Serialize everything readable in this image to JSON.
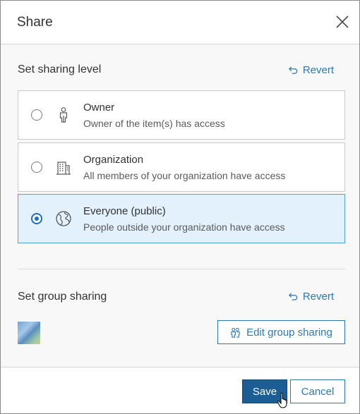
{
  "header": {
    "title": "Share"
  },
  "sharing_level": {
    "label": "Set sharing level",
    "revert_label": "Revert",
    "options": [
      {
        "title": "Owner",
        "description": "Owner of the item(s) has access",
        "icon": "person-icon",
        "selected": false
      },
      {
        "title": "Organization",
        "description": "All members of your organization have access",
        "icon": "building-icon",
        "selected": false
      },
      {
        "title": "Everyone (public)",
        "description": "People outside your organization have access",
        "icon": "globe-icon",
        "selected": true
      }
    ]
  },
  "group_sharing": {
    "label": "Set group sharing",
    "revert_label": "Revert",
    "edit_label": "Edit group sharing"
  },
  "footer": {
    "save_label": "Save",
    "cancel_label": "Cancel"
  },
  "colors": {
    "accent": "#2b78b6",
    "primary_button": "#1c5d94",
    "selected_bg": "#e2f1fb",
    "selected_border": "#4fa3d7"
  }
}
